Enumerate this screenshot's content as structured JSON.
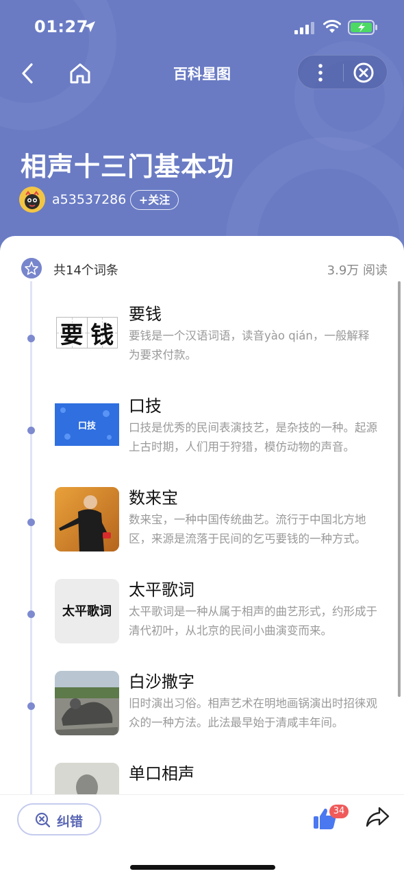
{
  "status_bar": {
    "time": "01:27"
  },
  "nav": {
    "title": "百科星图"
  },
  "page": {
    "title": "相声十三门基本功"
  },
  "author": {
    "name": "a53537286",
    "follow_label": "+关注"
  },
  "entries_header": {
    "count_label": "共14个词条",
    "read_count": "3.9万 阅读"
  },
  "items": [
    {
      "title": "要钱",
      "desc": "要钱是一个汉语词语，读音yào qián，一般解释为要求付款。",
      "thumb_text": "要钱"
    },
    {
      "title": "口技",
      "desc": "口技是优秀的民间表演技艺，是杂技的一种。起源上古时期，人们用于狩猎，模仿动物的声音。",
      "thumb_text": "口技"
    },
    {
      "title": "数来宝",
      "desc": "数来宝，一种中国传统曲艺。流行于中国北方地区，来源是流落于民间的乞丐要钱的一种方式。"
    },
    {
      "title": "太平歌词",
      "desc": "太平歌词是一种从属于相声的曲艺形式，约形成于清代初叶，从北京的民间小曲演变而来。",
      "thumb_text": "太平歌词"
    },
    {
      "title": "白沙撒字",
      "desc": "旧时演出习俗。相声艺术在明地画锅演出时招徕观众的一种方法。此法最早始于清咸丰年间。"
    },
    {
      "title": "单口相声",
      "desc": ""
    }
  ],
  "bottom_bar": {
    "report_label": "纠错",
    "like_count": "34"
  },
  "colors": {
    "header_bg": "#6a7bc4",
    "accent": "#7d8ad0",
    "badge": "#f05a5a"
  }
}
